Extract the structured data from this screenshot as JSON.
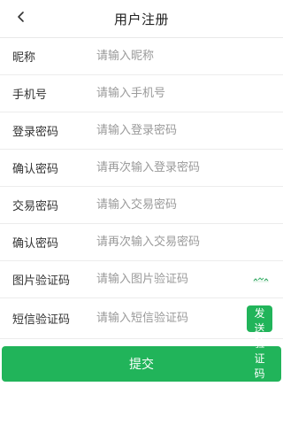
{
  "navbar": {
    "title": "用户注册",
    "back_icon": "chevron-left-icon"
  },
  "form": {
    "fields": [
      {
        "label": "昵称",
        "placeholder": "请输入昵称"
      },
      {
        "label": "手机号",
        "placeholder": "请输入手机号"
      },
      {
        "label": "登录密码",
        "placeholder": "请输入登录密码"
      },
      {
        "label": "确认密码",
        "placeholder": "请再次输入登录密码"
      },
      {
        "label": "交易密码",
        "placeholder": "请输入交易密码"
      },
      {
        "label": "确认密码",
        "placeholder": "请再次输入交易密码"
      },
      {
        "label": "图片验证码",
        "placeholder": "请输入图片验证码"
      },
      {
        "label": "短信验证码",
        "placeholder": "请输入短信验证码"
      }
    ],
    "send_code_label": "发送验证码",
    "submit_label": "提交"
  },
  "colors": {
    "accent": "#21b45a",
    "text": "#333333",
    "placeholder": "#9a9a9a",
    "divider": "#ececec"
  }
}
